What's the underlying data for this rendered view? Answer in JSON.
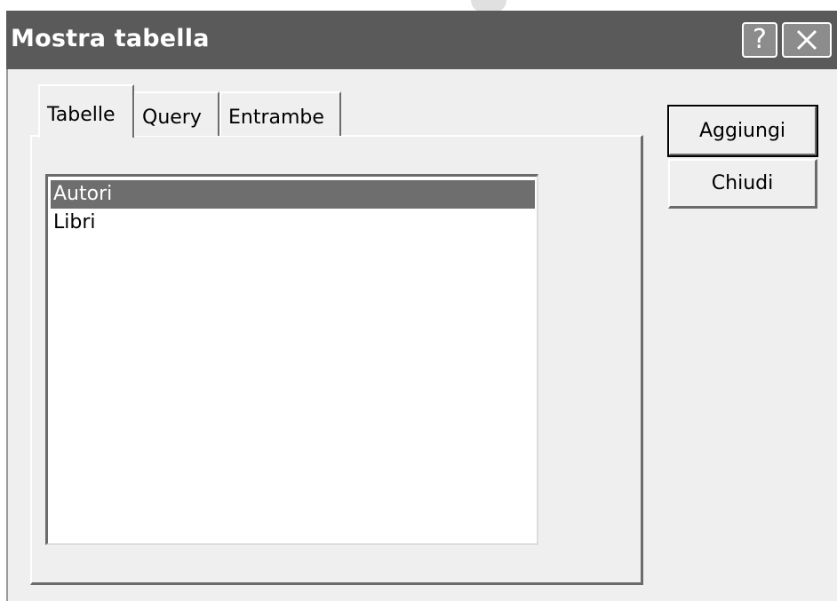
{
  "window": {
    "title": "Mostra tabella",
    "help_label": "?",
    "close_icon": "close-icon"
  },
  "tabs": [
    {
      "label": "Tabelle",
      "active": true
    },
    {
      "label": "Query",
      "active": false
    },
    {
      "label": "Entrambe",
      "active": false
    }
  ],
  "list": {
    "items": [
      {
        "label": "Autori",
        "selected": true
      },
      {
        "label": "Libri",
        "selected": false
      }
    ]
  },
  "buttons": {
    "add_label": "Aggiungi",
    "close_label": "Chiudi"
  },
  "colors": {
    "titlebar": "#5a5a5a",
    "dialog_bg": "#efefef",
    "selection": "#6e6e6e"
  }
}
